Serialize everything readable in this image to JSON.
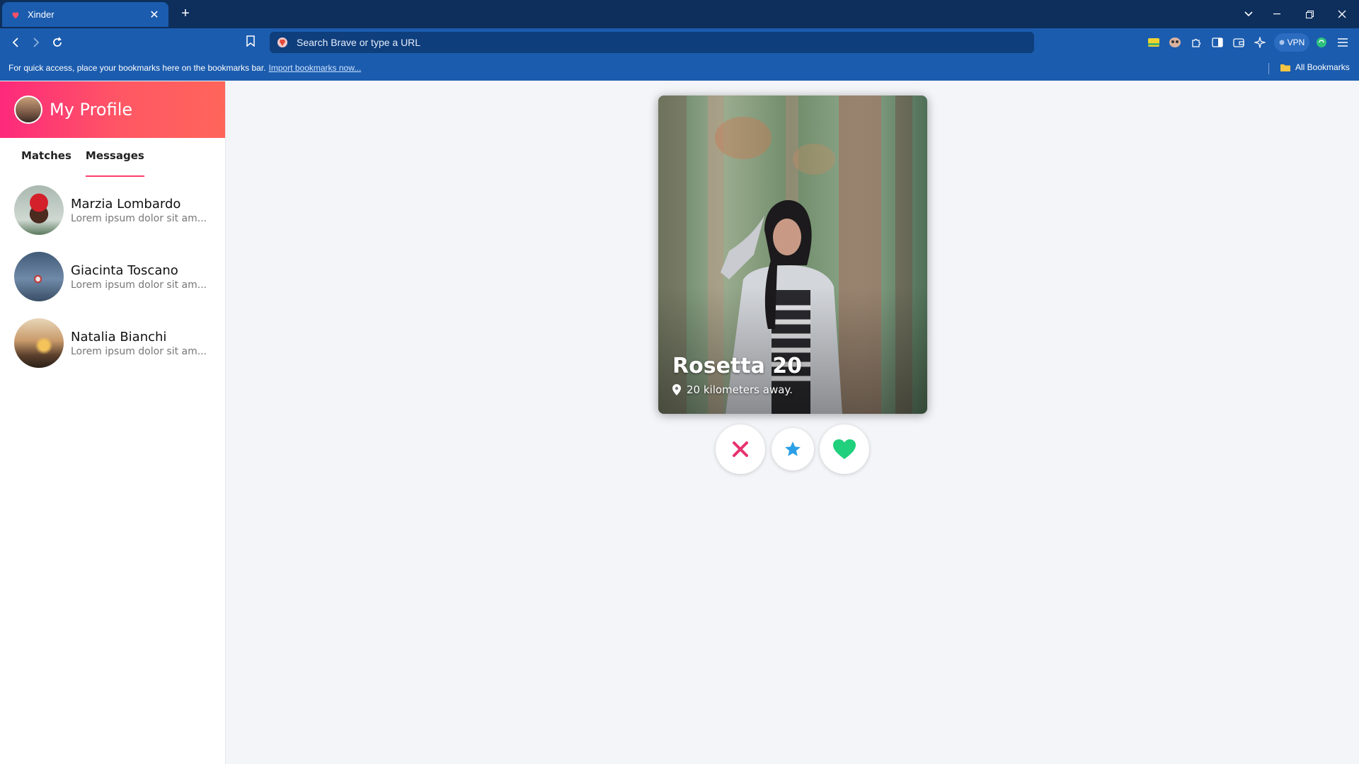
{
  "browser": {
    "tab_title": "Xinder",
    "address_placeholder": "Search Brave or type a URL",
    "vpn_label": "VPN",
    "bookmarks_message": "For quick access, place your bookmarks here on the bookmarks bar.",
    "bookmarks_link": "Import bookmarks now...",
    "all_bookmarks": "All Bookmarks"
  },
  "sidebar": {
    "profile_title": "My Profile",
    "tabs": [
      {
        "label": "Matches",
        "active": false
      },
      {
        "label": "Messages",
        "active": true
      }
    ],
    "conversations": [
      {
        "name": "Marzia Lombardo",
        "preview": "Lorem ipsum dolor sit am..."
      },
      {
        "name": "Giacinta Toscano",
        "preview": "Lorem ipsum dolor sit am..."
      },
      {
        "name": "Natalia Bianchi",
        "preview": "Lorem ipsum dolor sit am..."
      }
    ]
  },
  "card": {
    "name_age": "Rosetta 20",
    "distance": "20 kilometers away."
  },
  "actions": {
    "nope_icon": "close-icon",
    "superlike_icon": "star-icon",
    "like_icon": "heart-icon"
  },
  "colors": {
    "accent_pink": "#fd297b",
    "accent_coral": "#ff655b",
    "nope": "#e6316f",
    "superlike": "#2b9fe6",
    "like": "#21d07c",
    "browser_blue": "#1b5cae"
  }
}
